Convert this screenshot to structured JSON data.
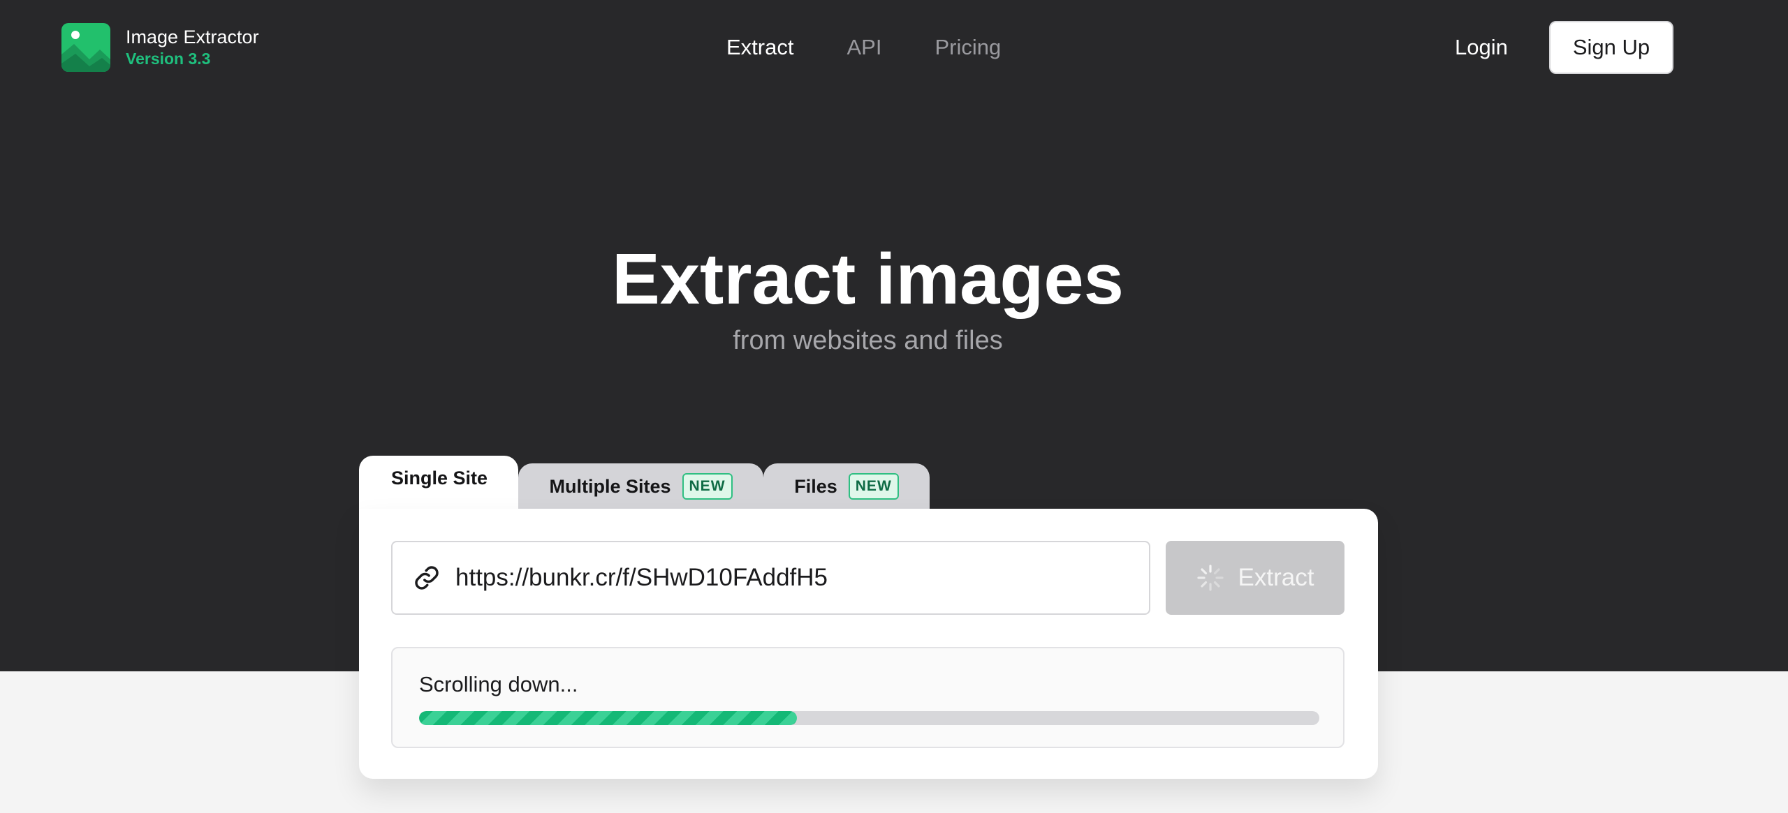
{
  "header": {
    "app_title": "Image Extractor",
    "version": "Version 3.3",
    "nav": [
      {
        "label": "Extract",
        "active": true
      },
      {
        "label": "API",
        "active": false
      },
      {
        "label": "Pricing",
        "active": false
      }
    ],
    "login_label": "Login",
    "signup_label": "Sign Up"
  },
  "hero": {
    "title": "Extract images",
    "subtitle": "from websites and files"
  },
  "tabs": [
    {
      "label": "Single Site",
      "active": true,
      "badge": ""
    },
    {
      "label": "Multiple Sites",
      "active": false,
      "badge": "NEW"
    },
    {
      "label": "Files",
      "active": false,
      "badge": "NEW"
    }
  ],
  "form": {
    "url_value": "https://bunkr.cr/f/SHwD10FAddfH5",
    "extract_label": "Extract",
    "extract_state": "loading"
  },
  "progress": {
    "status_text": "Scrolling down...",
    "fraction": 0.42
  },
  "colors": {
    "accent": "#14b876",
    "header_bg": "#28282a",
    "page_bg": "#f4f4f4"
  },
  "icons": {
    "logo": "mountain-image-icon",
    "url_field": "link-icon",
    "extract_button": "spinner-icon"
  }
}
